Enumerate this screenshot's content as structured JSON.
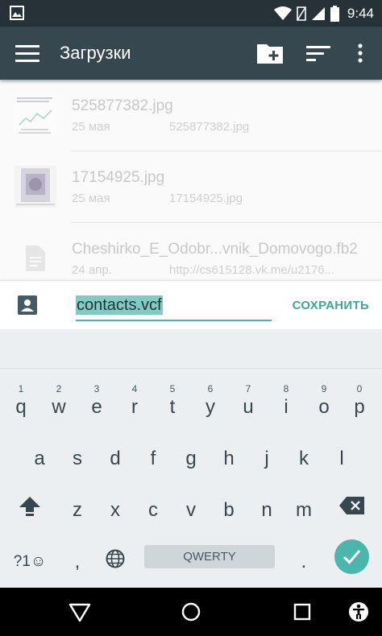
{
  "status_bar": {
    "time": "9:44",
    "icons": [
      "image-icon",
      "wifi-icon",
      "no-sim-icon",
      "signal-icon",
      "battery-icon"
    ]
  },
  "app_bar": {
    "title": "Загрузки",
    "icons": [
      "menu-icon",
      "new-folder-icon",
      "sort-icon",
      "more-vert-icon"
    ],
    "color": "#37474f"
  },
  "files": [
    {
      "name": "525877382.jpg",
      "date": "25 мая",
      "source": "525877382.jpg"
    },
    {
      "name": "17154925.jpg",
      "date": "25 мая",
      "source": "17154925.jpg"
    },
    {
      "name": "Cheshirko_E_Odobr...vnik_Domovogo.fb2",
      "date": "24 апр.",
      "source": "http://cs615128.vk.me/u2176..."
    }
  ],
  "save_panel": {
    "filename": "contacts.vcf",
    "save_label": "СОХРАНИТЬ",
    "accent": "#4db6ac"
  },
  "keyboard": {
    "row1": [
      {
        "key": "q",
        "hint": "1"
      },
      {
        "key": "w",
        "hint": "2"
      },
      {
        "key": "e",
        "hint": "3"
      },
      {
        "key": "r",
        "hint": "4"
      },
      {
        "key": "t",
        "hint": "5"
      },
      {
        "key": "y",
        "hint": "6"
      },
      {
        "key": "u",
        "hint": "7"
      },
      {
        "key": "i",
        "hint": "8"
      },
      {
        "key": "o",
        "hint": "9"
      },
      {
        "key": "p",
        "hint": "0"
      }
    ],
    "row2": [
      "a",
      "s",
      "d",
      "f",
      "g",
      "h",
      "j",
      "k",
      "l"
    ],
    "row3": [
      "z",
      "x",
      "c",
      "v",
      "b",
      "n",
      "m"
    ],
    "symbols_label": "?1☺",
    "comma": ",",
    "period": ".",
    "space_label": "QWERTY"
  },
  "nav_bar": {
    "icons": [
      "back-icon",
      "home-icon",
      "recents-icon",
      "accessibility-icon"
    ]
  }
}
